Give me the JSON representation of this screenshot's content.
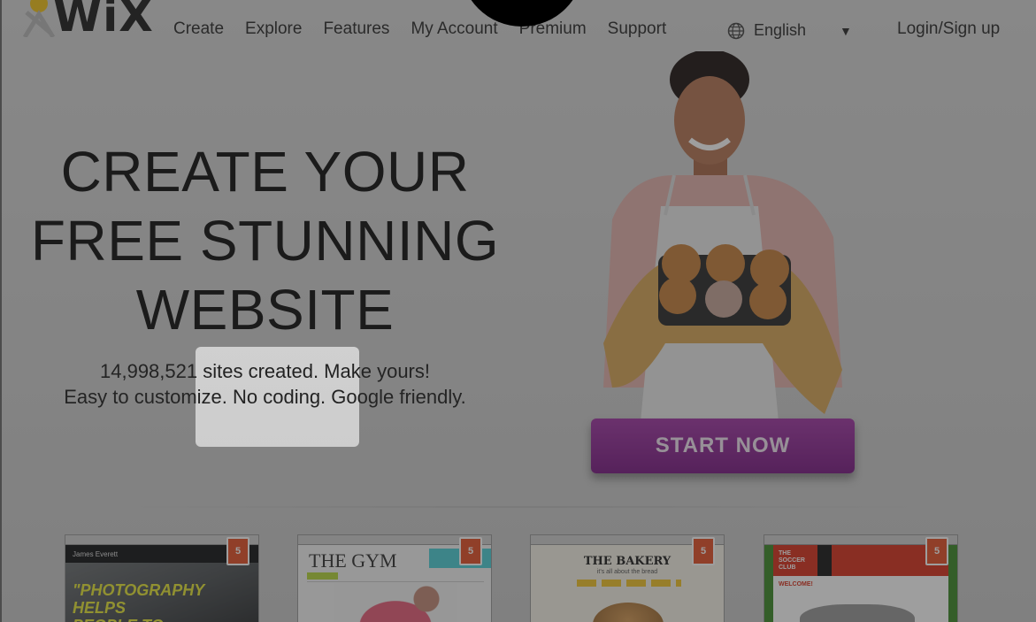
{
  "header": {
    "logo_text": "WiX",
    "nav": [
      "Create",
      "Explore",
      "Features",
      "My Account",
      "Premium",
      "Support"
    ],
    "language": "English",
    "login": "Login/Sign up"
  },
  "hero": {
    "headline_line1": "CREATE YOUR",
    "headline_line2": "FREE STUNNING",
    "headline_line3": "WEBSITE",
    "stat_line": "14,998,521 sites created. Make yours!",
    "tagline": "Easy to customize. No coding. Google friendly.",
    "cta": "START NOW"
  },
  "templates": [
    {
      "badge": "5",
      "title": "James Everett",
      "headline": "\"PHOTOGRAPHY HELPS PEOPLE TO"
    },
    {
      "badge": "5",
      "title": "THE GYM"
    },
    {
      "badge": "5",
      "title": "THE BAKERY",
      "tagline": "it's all about the bread"
    },
    {
      "badge": "5",
      "title": "THE SOCCER CLUB",
      "welcome": "WELCOME!"
    }
  ],
  "colors": {
    "cta": "#8b2791",
    "badge": "#e5532a"
  }
}
